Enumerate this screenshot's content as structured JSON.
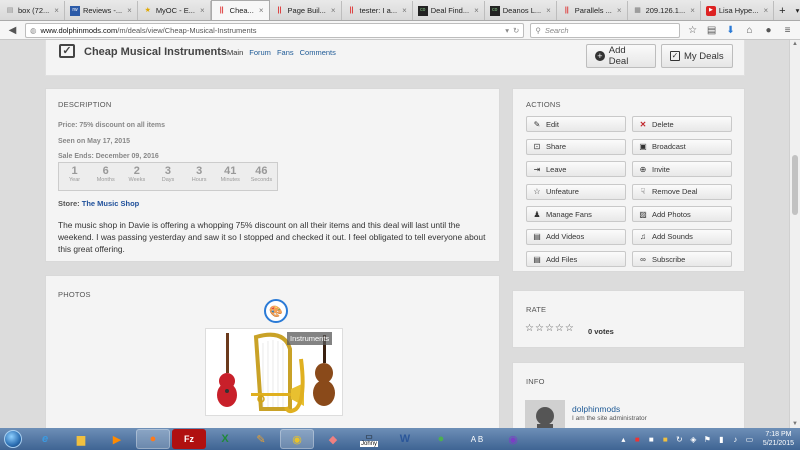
{
  "tabs": [
    {
      "label": "box (72...",
      "icon": "inbox-icon",
      "active": false
    },
    {
      "label": "Reviews -...",
      "icon": "reviews-icon",
      "active": false
    },
    {
      "label": "MyOC - E...",
      "icon": "star-icon",
      "active": false
    },
    {
      "label": "Chea...",
      "icon": "dm-logo-icon",
      "active": true
    },
    {
      "label": "Page Buil...",
      "icon": "dm-logo-icon",
      "active": false
    },
    {
      "label": "tester: I a...",
      "icon": "dm-logo-icon",
      "active": false
    },
    {
      "label": "Deal Find...",
      "icon": "deal-icon",
      "active": false
    },
    {
      "label": "Deanos L...",
      "icon": "deal-icon",
      "active": false
    },
    {
      "label": "Parallels ...",
      "icon": "dm-logo-icon",
      "active": false
    },
    {
      "label": "209.126.1...",
      "icon": "page-icon",
      "active": false
    },
    {
      "label": "Lisa Hype...",
      "icon": "youtube-icon",
      "active": false
    }
  ],
  "browser": {
    "url_base": "www.dolphinmods.com",
    "url_path": "/m/deals/view/Cheap-Musical-Instruments",
    "search_placeholder": "Search"
  },
  "header": {
    "title": "Cheap Musical Instruments",
    "links": [
      "Main",
      "Forum",
      "Fans",
      "Comments"
    ],
    "add_deal": "Add Deal",
    "my_deals": "My Deals"
  },
  "description": {
    "heading": "DESCRIPTION",
    "price": "Price: 75% discount on all items",
    "seen": "Seen on May 17, 2015",
    "sale_ends": "Sale Ends: December 09, 2016",
    "countdown": [
      {
        "value": "1",
        "unit": "Year"
      },
      {
        "value": "6",
        "unit": "Months"
      },
      {
        "value": "2",
        "unit": "Weeks"
      },
      {
        "value": "3",
        "unit": "Days"
      },
      {
        "value": "3",
        "unit": "Hours"
      },
      {
        "value": "41",
        "unit": "Minutes"
      },
      {
        "value": "46",
        "unit": "Seconds"
      }
    ],
    "store_label": "Store:",
    "store_name": "The Music Shop",
    "body": "The music shop in Davie is offering a whopping 75% discount on all their items and this deal will last until the weekend. I was passing yesterday and saw it so I stopped and checked it out. I feel obligated to tell everyone about this great offering."
  },
  "actions": {
    "heading": "ACTIONS",
    "buttons": [
      {
        "label": "Edit",
        "icon": "edit-icon"
      },
      {
        "label": "Delete",
        "icon": "delete-icon"
      },
      {
        "label": "Share",
        "icon": "share-icon"
      },
      {
        "label": "Broadcast",
        "icon": "broadcast-icon"
      },
      {
        "label": "Leave",
        "icon": "leave-icon"
      },
      {
        "label": "Invite",
        "icon": "invite-icon"
      },
      {
        "label": "Unfeature",
        "icon": "star-icon"
      },
      {
        "label": "Remove Deal",
        "icon": "thumbs-down-icon"
      },
      {
        "label": "Manage Fans",
        "icon": "users-icon"
      },
      {
        "label": "Add Photos",
        "icon": "photo-icon"
      },
      {
        "label": "Add Videos",
        "icon": "video-icon"
      },
      {
        "label": "Add Sounds",
        "icon": "music-icon"
      },
      {
        "label": "Add Files",
        "icon": "file-icon"
      },
      {
        "label": "Subscribe",
        "icon": "link-icon"
      }
    ]
  },
  "photos": {
    "heading": "PHOTOS",
    "caption": "Instruments"
  },
  "rate": {
    "heading": "RATE",
    "votes": "0 votes",
    "stars": 0,
    "max_stars": 5
  },
  "info": {
    "heading": "INFO",
    "username": "dolphinmods",
    "role": "I am the site administrator"
  },
  "taskbar": {
    "time": "7:18 PM",
    "date": "5/21/2015",
    "apps": [
      "ie-icon",
      "explorer-icon",
      "media-player-icon",
      "firefox-icon",
      "filezilla-icon",
      "excel-icon",
      "paint-icon",
      "chrome-icon",
      "eraser-icon",
      "johny-icon",
      "word-icon",
      "frog-icon",
      "ab-icon",
      "purple-app-icon"
    ],
    "johny_label": "Johny"
  }
}
